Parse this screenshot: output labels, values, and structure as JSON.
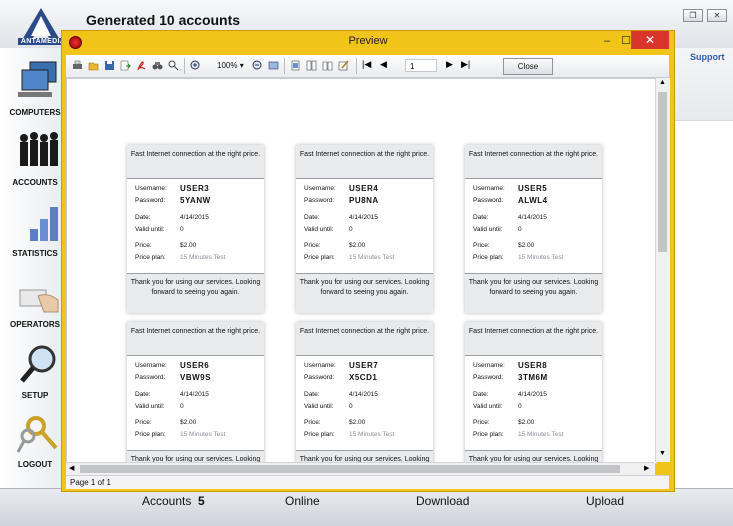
{
  "app": {
    "title": "Generated 10 accounts",
    "logo_text": "ANTAMEDIA",
    "support_label": "Support",
    "window_buttons": [
      "restore-icon",
      "close-icon"
    ]
  },
  "sidebar": {
    "items": [
      {
        "label": "COMPUTERS",
        "icon": "computers-icon"
      },
      {
        "label": "ACCOUNTS",
        "icon": "people-icon"
      },
      {
        "label": "STATISTICS",
        "icon": "bar-chart-icon"
      },
      {
        "label": "OPERATORS",
        "icon": "hand-card-icon"
      },
      {
        "label": "SETUP",
        "icon": "magnifier-icon"
      },
      {
        "label": "LOGOUT",
        "icon": "keys-icon"
      }
    ]
  },
  "bottom_bar": {
    "accounts_label": "Accounts",
    "accounts_count": "5",
    "online_label": "Online",
    "download_label": "Download",
    "upload_label": "Upload"
  },
  "preview": {
    "title": "Preview",
    "zoom": "100%",
    "page_input": "1",
    "close_label": "Close",
    "status": "Page 1 of 1",
    "toolbar_icons": [
      "print-icon",
      "open-icon",
      "save-icon",
      "export-icon",
      "pdf-icon",
      "binoculars-icon",
      "find-icon",
      "zoom-in-icon",
      "zoom-out-icon",
      "fit-page-icon",
      "single-page-icon",
      "multi-page-icon",
      "book-icon",
      "edit-icon",
      "first-page-icon",
      "prev-page-icon",
      "next-page-icon",
      "last-page-icon"
    ]
  },
  "voucher_labels": {
    "header": "Fast Internet connection at the right price.",
    "username": "Username:",
    "password": "Password:",
    "date": "Date:",
    "valid_until": "Valid until:",
    "price": "Price:",
    "price_plan": "Price plan:",
    "footer": "Thank you for using our services. Looking forward to seeing you again."
  },
  "vouchers": [
    {
      "username": "USER3",
      "password": "5YANW",
      "date": "4/14/2015",
      "valid_until": "0",
      "price": "$2.00",
      "price_plan": "15 Minutes Test"
    },
    {
      "username": "USER4",
      "password": "PU8NA",
      "date": "4/14/2015",
      "valid_until": "0",
      "price": "$2.00",
      "price_plan": "15 Minutes Test"
    },
    {
      "username": "USER5",
      "password": "ALWL4",
      "date": "4/14/2015",
      "valid_until": "0",
      "price": "$2.00",
      "price_plan": "15 Minutes Test"
    },
    {
      "username": "USER6",
      "password": "VBW9S",
      "date": "4/14/2015",
      "valid_until": "0",
      "price": "$2.00",
      "price_plan": "15 Minutes Test"
    },
    {
      "username": "USER7",
      "password": "X5CD1",
      "date": "4/14/2015",
      "valid_until": "0",
      "price": "$2.00",
      "price_plan": "15 Minutes Test"
    },
    {
      "username": "USER8",
      "password": "3TM6M",
      "date": "4/14/2015",
      "valid_until": "0",
      "price": "$2.00",
      "price_plan": "15 Minutes Test"
    }
  ]
}
